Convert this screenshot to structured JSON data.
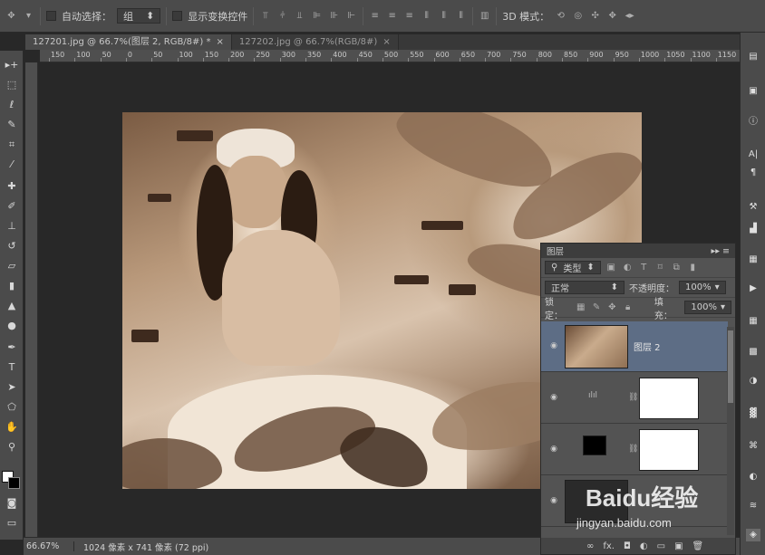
{
  "options_bar": {
    "auto_select_label": "自动选择：",
    "auto_select_value": "组",
    "show_transform_label": "显示变换控件",
    "mode_3d_label": "3D 模式："
  },
  "tabs": [
    {
      "label": "127201.jpg @ 66.7%(图层 2, RGB/8#) *",
      "close": "×"
    },
    {
      "label": "127202.jpg @ 66.7%(RGB/8#)",
      "close": "×"
    }
  ],
  "ruler": {
    "h_labels": [
      "150",
      "100",
      "50",
      "0",
      "50",
      "100",
      "150",
      "200",
      "250",
      "300",
      "350",
      "400",
      "450",
      "500",
      "550",
      "600",
      "650",
      "700",
      "750",
      "800",
      "850",
      "900",
      "950",
      "1000",
      "1050",
      "1100",
      "1150"
    ]
  },
  "status": {
    "zoom": "66.67%",
    "doc_info": "1024 像素 x 741 像素 (72 ppi)"
  },
  "layers_panel": {
    "title": "图层",
    "filter_kind": "类型",
    "blend_mode": "正常",
    "opacity_label": "不透明度：",
    "opacity_value": "100%",
    "lock_label": "锁定：",
    "fill_label": "填充：",
    "fill_value": "100%",
    "layers": [
      {
        "name": "图层 2",
        "selected": true
      },
      {
        "name": "",
        "selected": false
      },
      {
        "name": "",
        "selected": false
      },
      {
        "name": "",
        "selected": false
      }
    ],
    "footer": "fx."
  },
  "watermark": {
    "brand": "Baidu经验",
    "url": "jingyan.baidu.com"
  },
  "colors": {
    "panel": "#535353",
    "selected_layer": "#5d6d85",
    "chrome": "#4b4b4b"
  }
}
